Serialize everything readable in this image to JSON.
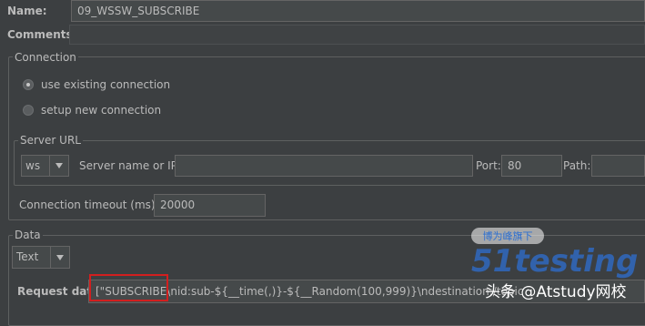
{
  "name": {
    "label": "Name:",
    "value": "09_WSSW_SUBSCRIBE"
  },
  "comments": {
    "label": "Comments:"
  },
  "connection": {
    "legend": "Connection",
    "use_existing": "use existing connection",
    "setup_new": "setup new connection",
    "selected": "use existing connection"
  },
  "server_url": {
    "legend": "Server URL",
    "protocol": "ws",
    "server_label": "Server name or IP:",
    "server_value": "",
    "port_label": "Port:",
    "port_value": "80",
    "path_label": "Path:",
    "path_value": ""
  },
  "timeout": {
    "label": "Connection timeout (ms):",
    "value": "20000"
  },
  "data": {
    "legend": "Data",
    "type": "Text",
    "request_label": "Request data:",
    "request_value": "[\"SUBSCRIBE\\nid:sub-${__time(,)}-${__Random(100,999)}\\ndestination:/topic"
  },
  "watermark": {
    "badge": "博为峰旗下",
    "brand": "51testing",
    "caption": "头条 @Atstudy网校"
  },
  "colors": {
    "highlight": "#d21f1f",
    "panel": "#3c3f41"
  }
}
